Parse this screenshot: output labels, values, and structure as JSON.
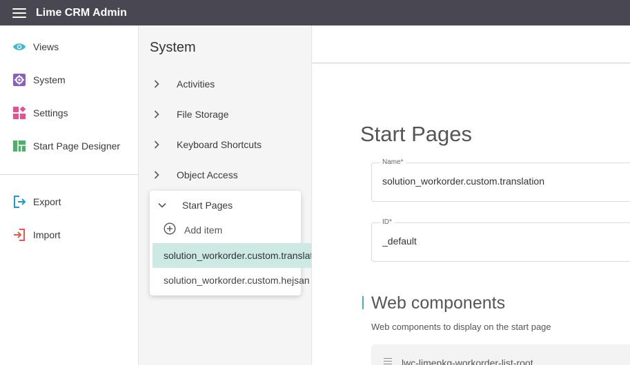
{
  "app": {
    "title": "Lime CRM Admin"
  },
  "nav": {
    "items": [
      {
        "label": "Views",
        "icon": "eye-icon"
      },
      {
        "label": "System",
        "icon": "gear-icon"
      },
      {
        "label": "Settings",
        "icon": "widgets-icon"
      },
      {
        "label": "Start Page Designer",
        "icon": "layout-icon"
      },
      {
        "label": "Export",
        "icon": "export-icon"
      },
      {
        "label": "Import",
        "icon": "import-icon"
      }
    ]
  },
  "sub": {
    "title": "System",
    "items": [
      {
        "label": "Activities"
      },
      {
        "label": "File Storage"
      },
      {
        "label": "Keyboard Shortcuts"
      },
      {
        "label": "Object Access"
      }
    ],
    "expanded": {
      "label": "Start Pages",
      "add_label": "Add item",
      "children": [
        {
          "label": "solution_workorder.custom.translation",
          "selected": true
        },
        {
          "label": "solution_workorder.custom.hejsan",
          "selected": false
        }
      ]
    }
  },
  "main": {
    "title": "Start Pages",
    "name_field": {
      "label": "Name*",
      "value": "solution_workorder.custom.translation"
    },
    "id_field": {
      "label": "ID*",
      "value": "_default"
    },
    "web_components": {
      "title": "Web components",
      "description": "Web components to display on the start page",
      "first_item": "lwc-limepkg-workorder-list-root"
    }
  },
  "colors": {
    "topbar": "#484752",
    "accent": "#41b5a9",
    "selected_row": "#cde9e3",
    "views_icon": "#3db7d6",
    "system_icon": "#8a5fc4",
    "settings_icon": "#ea4f8f",
    "layout_icon": "#4caf6a",
    "export_icon": "#2196d3",
    "import_icon": "#e8584a"
  }
}
